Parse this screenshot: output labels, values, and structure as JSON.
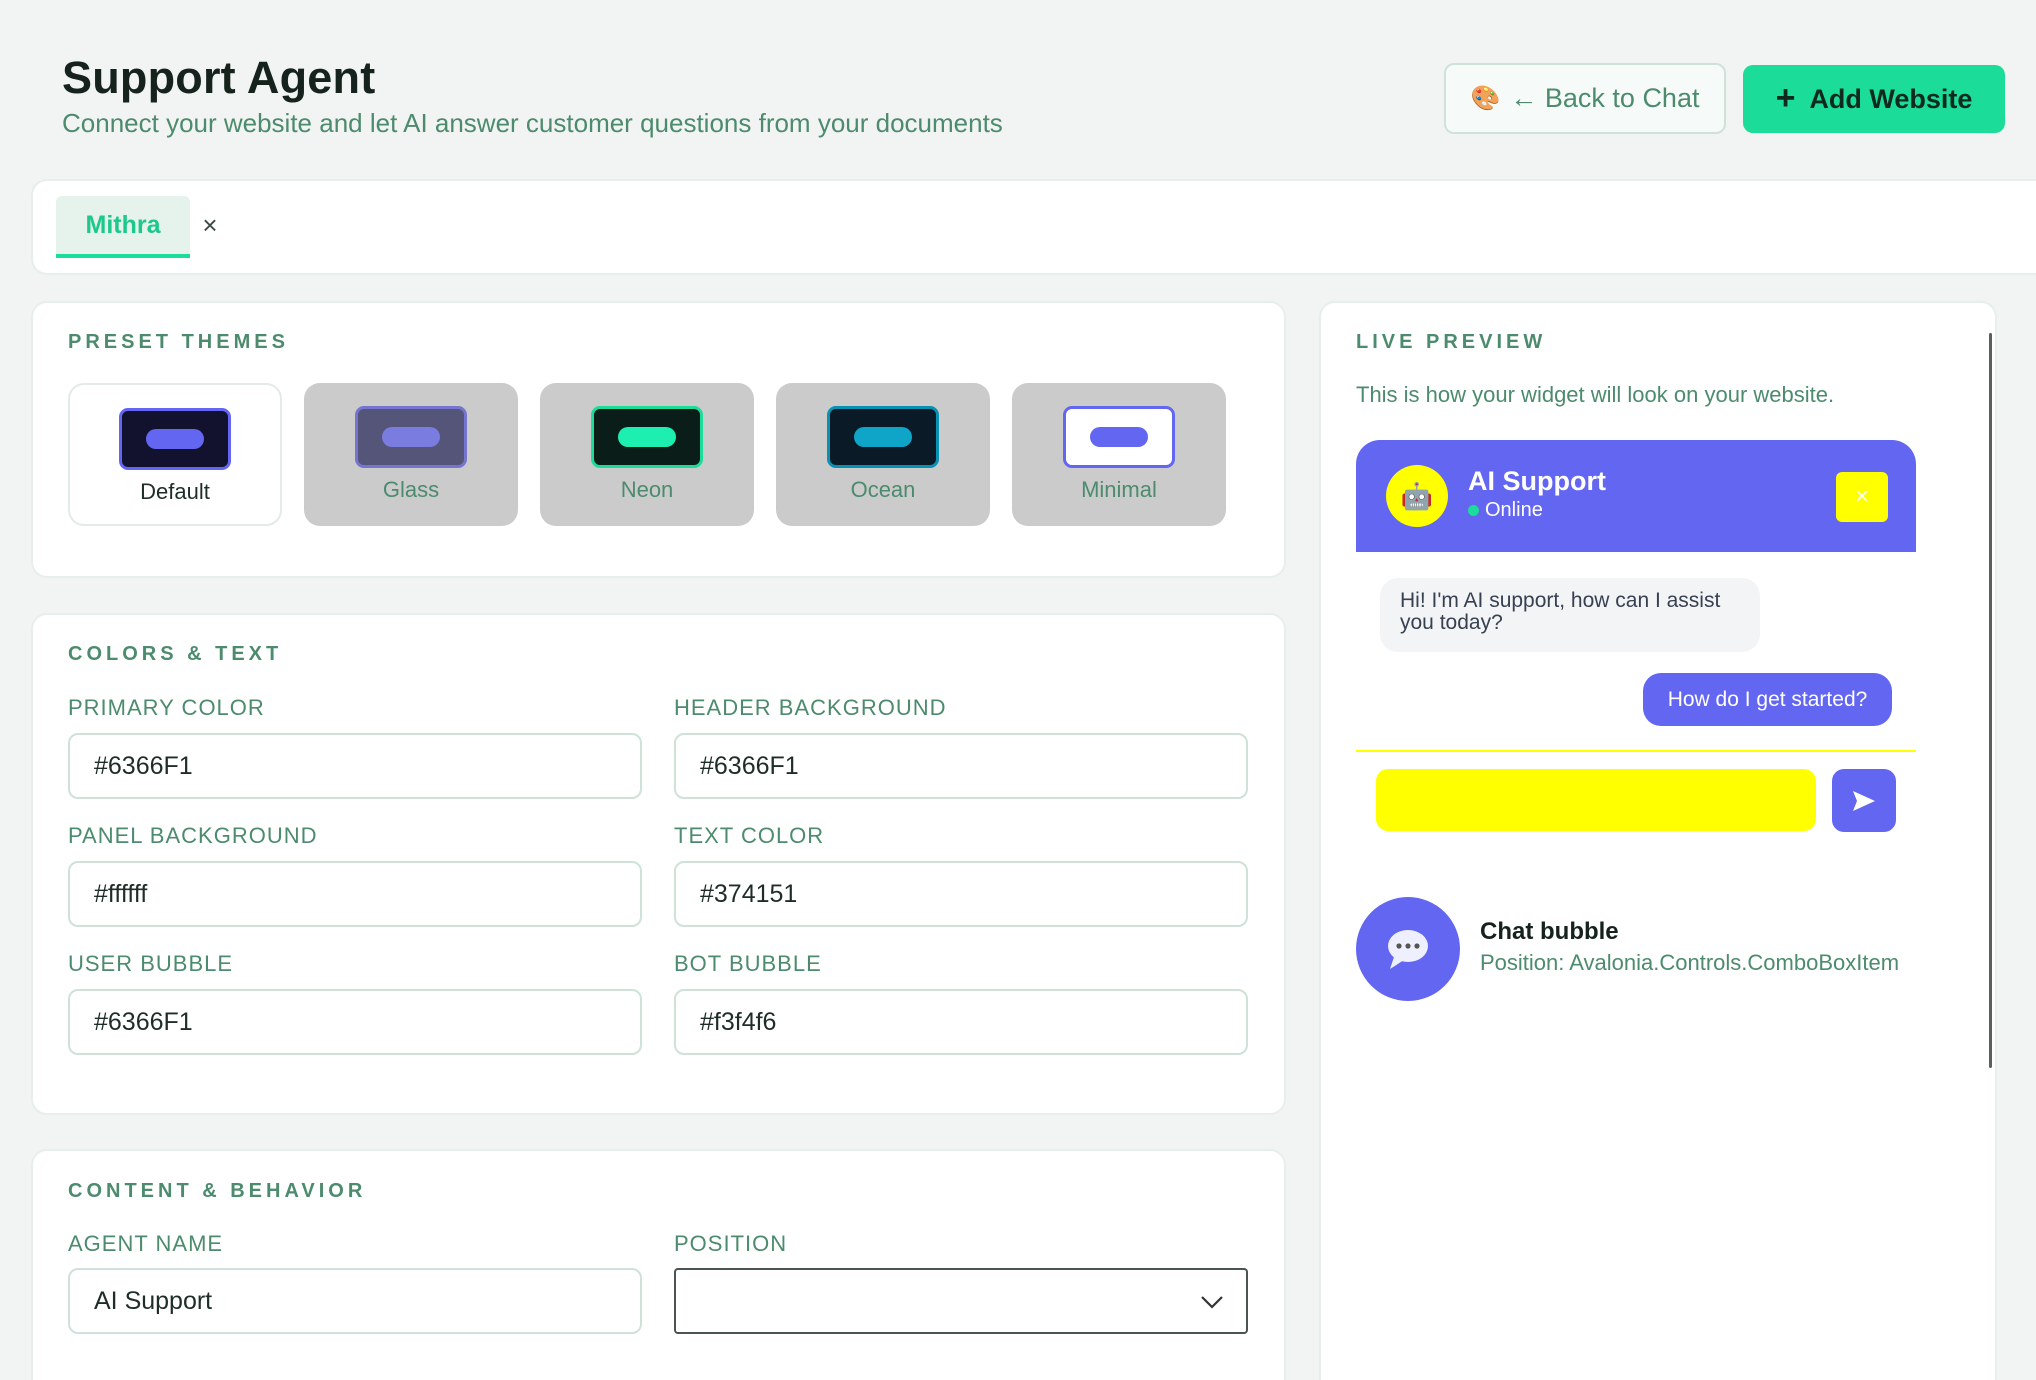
{
  "header": {
    "title": "Support Agent",
    "subtitle": "Connect your website and let AI answer customer questions from your documents",
    "back_button_label": "← Back to Chat",
    "back_button_icon": "🎨",
    "add_button_label": "Add Website",
    "add_button_icon": "+"
  },
  "websites": {
    "tabs": [
      {
        "label": "Mithra",
        "active": true
      }
    ],
    "close_glyph": "×"
  },
  "preset_themes": {
    "title": "PRESET THEMES",
    "items": [
      {
        "label": "Default",
        "selected": true
      },
      {
        "label": "Glass",
        "selected": false
      },
      {
        "label": "Neon",
        "selected": false
      },
      {
        "label": "Ocean",
        "selected": false
      },
      {
        "label": "Minimal",
        "selected": false
      }
    ]
  },
  "colors_text": {
    "title": "COLORS & TEXT",
    "fields": {
      "primary_color": {
        "label": "PRIMARY COLOR",
        "value": "#6366F1"
      },
      "header_background": {
        "label": "HEADER BACKGROUND",
        "value": "#6366F1"
      },
      "panel_background": {
        "label": "PANEL BACKGROUND",
        "value": "#ffffff"
      },
      "text_color": {
        "label": "TEXT COLOR",
        "value": "#374151"
      },
      "user_bubble": {
        "label": "USER BUBBLE",
        "value": "#6366F1"
      },
      "bot_bubble": {
        "label": "BOT BUBBLE",
        "value": "#f3f4f6"
      }
    }
  },
  "content_behavior": {
    "title": "CONTENT & BEHAVIOR",
    "agent_name": {
      "label": "AGENT NAME",
      "value": "AI Support"
    },
    "position": {
      "label": "POSITION",
      "value": ""
    }
  },
  "live_preview": {
    "title": "LIVE PREVIEW",
    "description": "This is how your widget will look on your website.",
    "widget": {
      "bot_name": "AI Support",
      "status": "Online",
      "bot_avatar_icon": "🤖",
      "close_glyph": "×",
      "messages": {
        "bot": "Hi! I'm AI support, how can I assist you today?",
        "user": "How do I get started?"
      }
    },
    "chat_bubble": {
      "title": "Chat bubble",
      "position_text": "Position: Avalonia.Controls.ComboBoxItem"
    }
  },
  "colors": {
    "accent": "#1cdc99",
    "label_green": "#4c8b6d",
    "widget_primary": "#6366f1",
    "widget_highlight": "#ffff00"
  }
}
